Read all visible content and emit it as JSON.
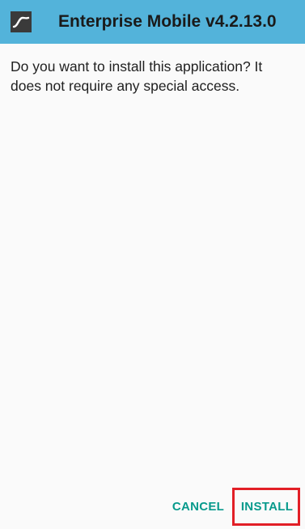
{
  "app_bar": {
    "icon": "enterprise-mobile-app-icon",
    "title": "Enterprise Mobile v4.2.13.0"
  },
  "message": "Do you want to install this application? It does not require any special access.",
  "actions": {
    "cancel_label": "CANCEL",
    "install_label": "INSTALL"
  },
  "colors": {
    "app_bar": "#53b3da",
    "accent": "#079a8c",
    "highlight": "#e21f26",
    "background": "#fafafa"
  }
}
